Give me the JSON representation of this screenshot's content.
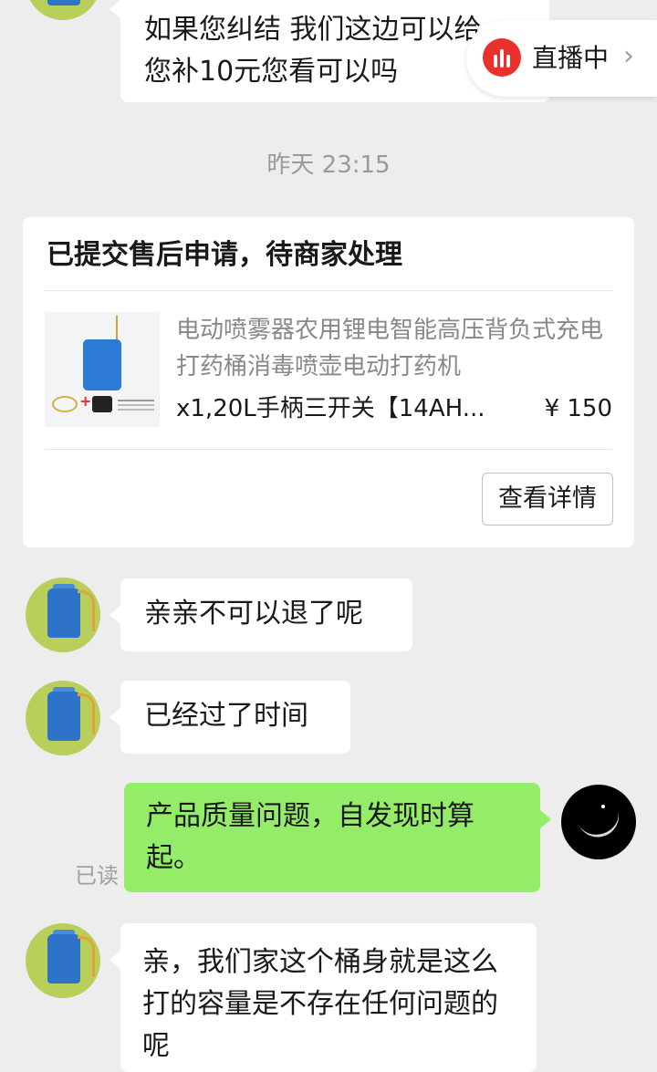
{
  "live": {
    "label": "直播中",
    "arrow": "›"
  },
  "messages_top": {
    "line1": "如果您纠结 我们这边可以给",
    "line2": "您补10元您看可以吗"
  },
  "timestamp": "昨天 23:15",
  "aftersale_card": {
    "title": "已提交售后申请，待商家处理",
    "product_name": "电动喷雾器农用锂电智能高压背负式充电打药桶消毒喷壶电动打药机",
    "spec": "x1,20L手柄三开关【14AH...",
    "price": "¥ 150",
    "detail_button": "查看详情"
  },
  "chat": [
    {
      "from": "merchant",
      "text": "亲亲不可以退了呢"
    },
    {
      "from": "merchant",
      "text": "已经过了时间"
    },
    {
      "from": "me",
      "text": "产品质量问题，自发现时算起。",
      "status": "已读"
    },
    {
      "from": "merchant",
      "text": "亲，我们家这个桶身就是这么打的容量是不存在任何问题的呢"
    }
  ]
}
